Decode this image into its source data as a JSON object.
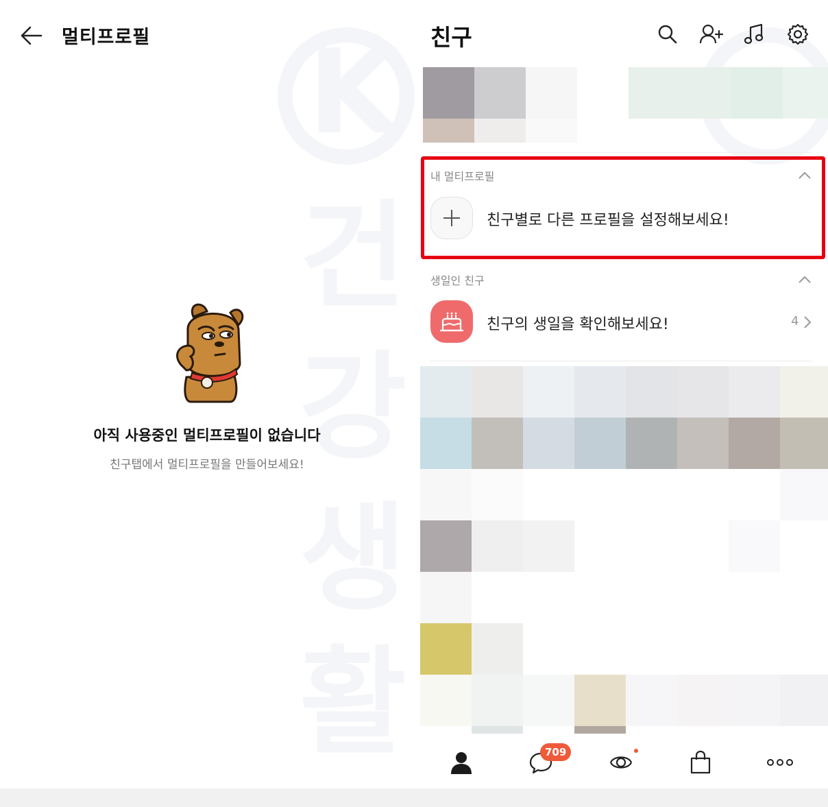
{
  "multiprofile_page": {
    "title": "멀티프로필",
    "empty_title": "아직 사용중인 멀티프로필이 없습니다",
    "empty_subtitle": "친구탭에서 멀티프로필을 만들어보세요!"
  },
  "friends_page": {
    "title": "친구",
    "header_icons": [
      "search-icon",
      "add-friend-icon",
      "music-icon",
      "settings-icon"
    ],
    "my_multiprofile": {
      "section_label": "내 멀티프로필",
      "add_text": "친구별로 다른 프로필을 설정해보세요!"
    },
    "birthday": {
      "section_label": "생일인 친구",
      "text": "친구의 생일을 확인해보세요!",
      "count": "4"
    },
    "bottom_nav": {
      "items": [
        "friends-icon",
        "chat-icon",
        "view-icon",
        "shopping-icon",
        "more-icon"
      ],
      "chat_badge": "709"
    }
  },
  "colors": {
    "highlight": "#e60012",
    "badge": "#ee5a3a",
    "cake": "#ef6b6b"
  },
  "watermark": [
    "건",
    "강",
    "생",
    "활"
  ]
}
